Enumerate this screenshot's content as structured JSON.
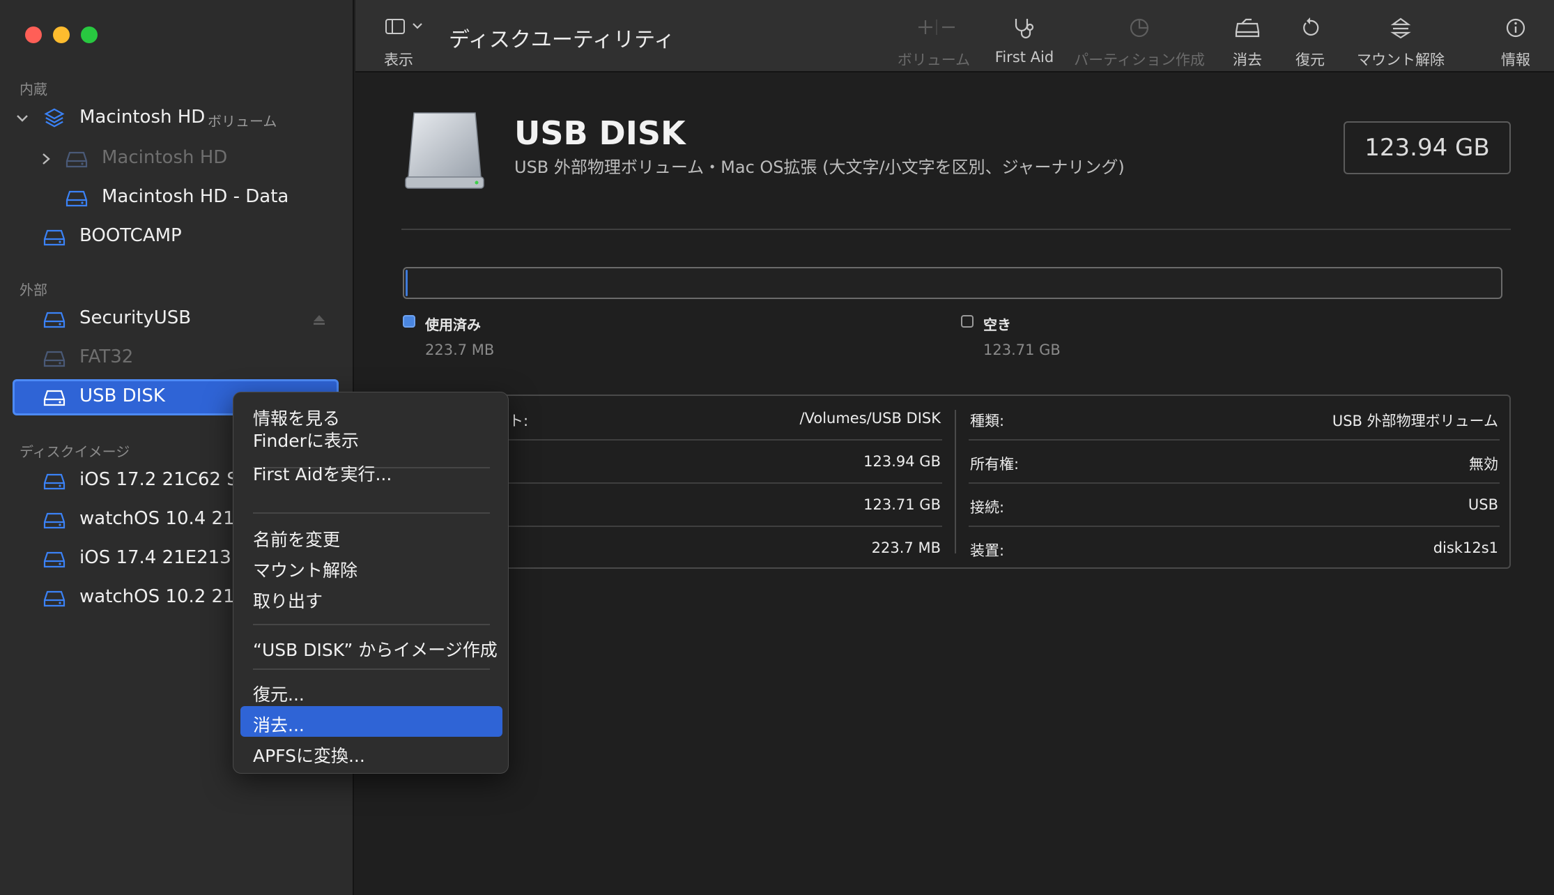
{
  "window": {
    "title": "ディスクユーティリティ"
  },
  "toolbar": {
    "view_label": "表示",
    "volume_label": "ボリューム",
    "firstaid_label": "First Aid",
    "partition_label": "パーティション作成",
    "erase_label": "消去",
    "restore_label": "復元",
    "unmount_label": "マウント解除",
    "info_label": "情報"
  },
  "sidebar": {
    "internal_header": "内蔵",
    "external_header": "外部",
    "images_header": "ディスクイメージ",
    "internal": [
      {
        "label": "Macintosh HD",
        "suffix": "ボリューム"
      },
      {
        "label": "Macintosh HD"
      },
      {
        "label": "Macintosh HD - Data"
      },
      {
        "label": "BOOTCAMP"
      }
    ],
    "external": [
      {
        "label": "SecurityUSB"
      },
      {
        "label": "FAT32"
      },
      {
        "label": "USB DISK"
      }
    ],
    "images": [
      {
        "label": "iOS 17.2 21C62 Sir"
      },
      {
        "label": "watchOS 10.4 21T"
      },
      {
        "label": "iOS 17.4 21E213 Si"
      },
      {
        "label": "watchOS 10.2 21S"
      }
    ]
  },
  "disk": {
    "name": "USB DISK",
    "subtitle": "USB 外部物理ボリューム・Mac OS拡張 (大文字/小文字を区別、ジャーナリング)",
    "capacity": "123.94 GB",
    "used_label": "使用済み",
    "used_value": "223.7 MB",
    "free_label": "空き",
    "free_value": "123.71 GB",
    "used_fraction": 0.0018
  },
  "info": {
    "left": [
      {
        "label": "ト:",
        "value": "/Volumes/USB DISK"
      },
      {
        "label": "",
        "value": "123.94 GB"
      },
      {
        "label": "",
        "value": "123.71 GB"
      },
      {
        "label": "",
        "value": "223.7 MB"
      }
    ],
    "right": [
      {
        "label": "種類:",
        "value": "USB 外部物理ボリューム"
      },
      {
        "label": "所有権:",
        "value": "無効"
      },
      {
        "label": "接続:",
        "value": "USB"
      },
      {
        "label": "装置:",
        "value": "disk12s1"
      }
    ]
  },
  "context_menu": {
    "items": [
      "情報を見る",
      "Finderに表示",
      "First Aidを実行...",
      "名前を変更",
      "マウント解除",
      "取り出す",
      "“USB DISK” からイメージ作成",
      "復元...",
      "消去...",
      "APFSに変換..."
    ],
    "highlighted": "消去..."
  },
  "colors": {
    "accent": "#2f64d6",
    "icon_blue": "#3b82f6",
    "close": "#ff5f57",
    "minimize": "#febc2e",
    "zoom": "#28c840"
  }
}
